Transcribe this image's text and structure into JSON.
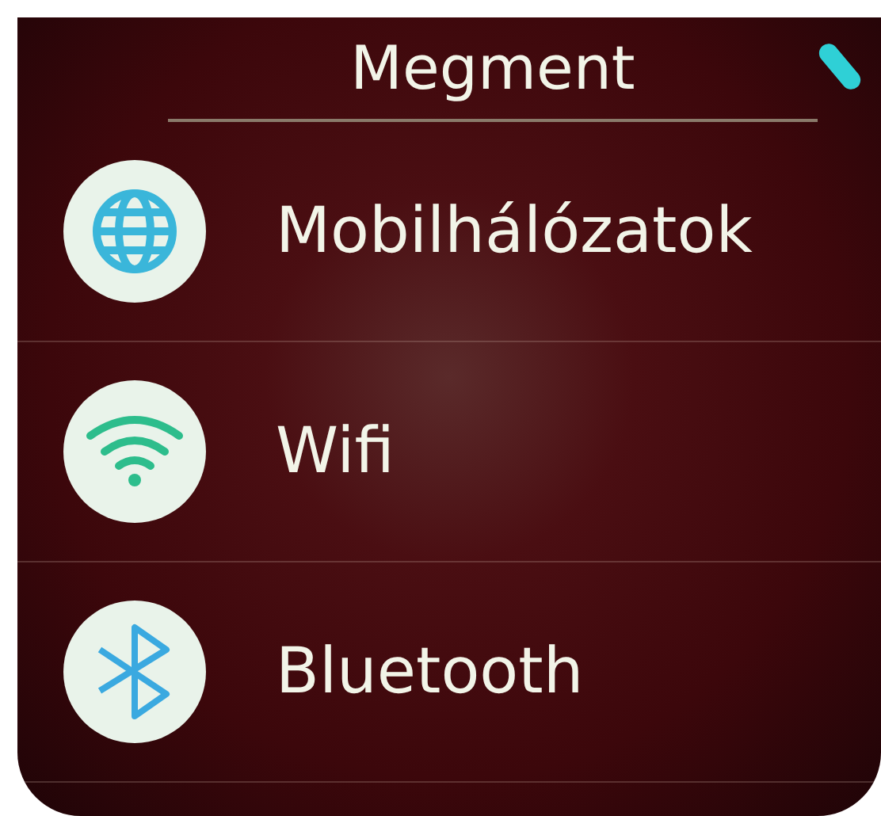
{
  "header": {
    "title": "Megment"
  },
  "items": [
    {
      "label": "Mobilhálózatok",
      "kind": "mobile"
    },
    {
      "label": "Wifi",
      "kind": "wifi"
    },
    {
      "label": "Bluetooth",
      "kind": "bluetooth"
    }
  ]
}
